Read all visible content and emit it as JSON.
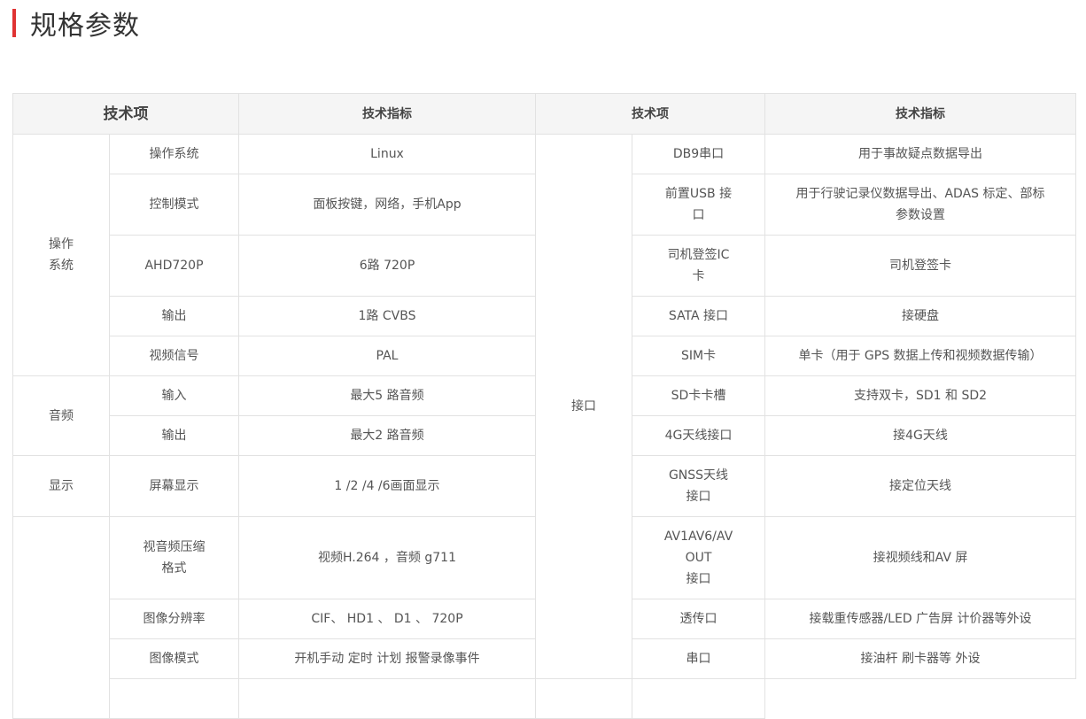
{
  "page_title": "规格参数",
  "header": {
    "left_item": "技术项",
    "left_indicator": "技术指标",
    "right_item": "技术项",
    "right_indicator": "技术指标"
  },
  "left_groups": {
    "os": "操作\n系统",
    "audio": "音频",
    "display": "显示"
  },
  "right_group": "接口",
  "rows": [
    {
      "left_item": "操作系统",
      "left_value": "Linux",
      "right_item": "DB9串口",
      "right_value": "用于事故疑点数据导出"
    },
    {
      "left_item": "控制模式",
      "left_value": "面板按键，网络，手机App",
      "right_item": "前置USB 接\n口",
      "right_value": "用于行驶记录仪数据导出、ADAS 标定、部标\n参数设置"
    },
    {
      "left_item": "AHD720P",
      "left_value": "6路 720P",
      "right_item": "司机登签IC\n卡",
      "right_value": "司机登签卡"
    },
    {
      "left_item": "输出",
      "left_value": "1路 CVBS",
      "right_item": "SATA 接口",
      "right_value": "接硬盘"
    },
    {
      "left_item": "视频信号",
      "left_value": "PAL",
      "right_item": "SIM卡",
      "right_value": "单卡（用于 GPS 数据上传和视频数据传输）"
    },
    {
      "left_item": "输入",
      "left_value": "最大5 路音频",
      "right_item": "SD卡卡槽",
      "right_value": "支持双卡，SD1 和 SD2"
    },
    {
      "left_item": "输出",
      "left_value": "最大2 路音频",
      "right_item": "4G天线接口",
      "right_value": "接4G天线"
    },
    {
      "left_item": "屏幕显示",
      "left_value": "1 /2 /4 /6画面显示",
      "right_item": "GNSS天线\n接口",
      "right_value": "接定位天线"
    },
    {
      "left_item": "视音频压缩\n格式",
      "left_value": "视频H.264 ，音频 g711",
      "right_item": "AV1AV6/AV\nOUT\n接口",
      "right_value": "接视频线和AV 屏"
    },
    {
      "left_item": "图像分辨率",
      "left_value": "CIF、 HD1 、 D1 、 720P",
      "right_item": "透传口",
      "right_value": "接载重传感器/LED 广告屏 计价器等外设"
    },
    {
      "left_item": "图像模式",
      "left_value": "开机手动 定时 计划 报警录像事件",
      "right_item": "串口",
      "right_value": "接油杆 刷卡器等 外设"
    }
  ]
}
